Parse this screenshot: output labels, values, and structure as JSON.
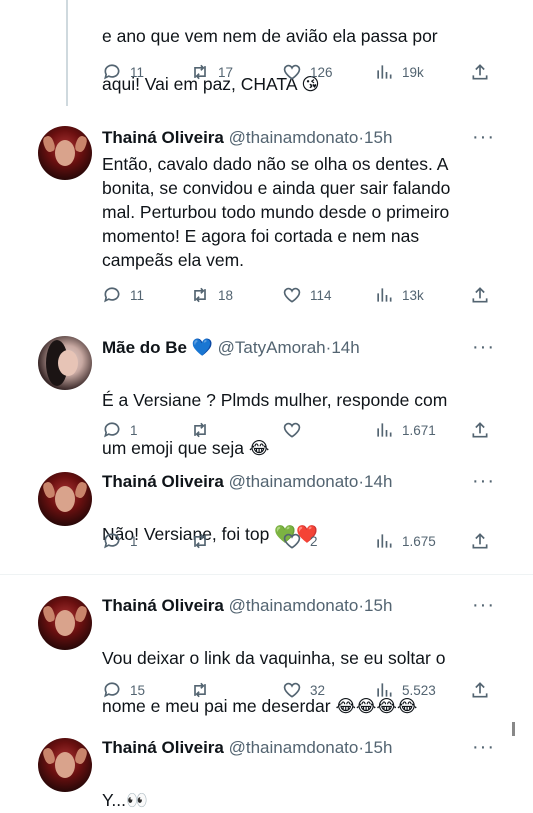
{
  "top_tweet": {
    "text_line1": "e ano que vem nem de avião ela passa por",
    "text_line2": "aqui! Vai em paz, CHATA",
    "emoji": "😘",
    "replies": "11",
    "retweets": "17",
    "likes": "126",
    "views": "19k"
  },
  "tweets": [
    {
      "name": "Thainá Oliveira",
      "handle": "@thainamdonato",
      "time": "15h",
      "text": "Então, cavalo dado não se olha os dentes. A\nbonita, se convidou e ainda quer sair falando\nmal. Perturbou todo mundo desde o primeiro\nmomento! E agora foi cortada e nem nas\ncampeãs ela vem.",
      "replies": "11",
      "retweets": "18",
      "likes": "114",
      "views": "13k"
    },
    {
      "name": "Mãe do Be",
      "name_emoji": "💙",
      "handle": "@TatyAmorah",
      "time": "14h",
      "text_line1": "É a Versiane ? Plmds mulher, responde com",
      "text_line2": "um emoji que seja",
      "text_emoji": "😂",
      "replies": "1",
      "retweets": "",
      "likes": "",
      "views": "1.671"
    },
    {
      "name": "Thainá Oliveira",
      "handle": "@thainamdonato",
      "time": "14h",
      "text": "Não! Versiane, foi top",
      "emoji1": "💚",
      "emoji2": "❤️",
      "replies": "1",
      "retweets": "",
      "likes": "2",
      "views": "1.675"
    },
    {
      "name": "Thainá Oliveira",
      "handle": "@thainamdonato",
      "time": "15h",
      "text_line1": "Vou deixar o link da vaquinha, se eu soltar o",
      "text_line2": "nome e meu  pai me deserdar",
      "text_emoji": "😂😂😂😂",
      "replies": "15",
      "retweets": "",
      "likes": "32",
      "views": "5.523"
    },
    {
      "name": "Thainá Oliveira",
      "handle": "@thainamdonato",
      "time": "15h",
      "text": "Y...",
      "text_emoji": "👀"
    }
  ],
  "more_label": "···",
  "separator": "·"
}
